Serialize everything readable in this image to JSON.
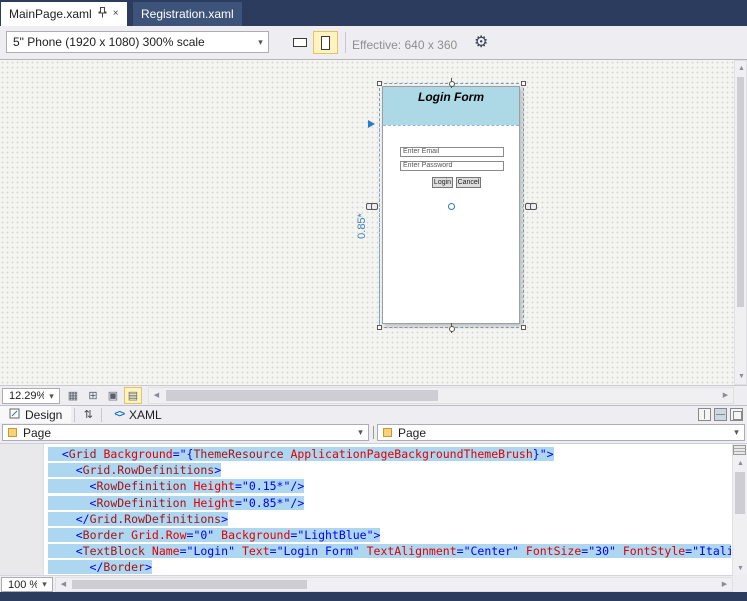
{
  "window": {
    "document_tabs": [
      {
        "label": "MainPage.xaml",
        "active": true
      },
      {
        "label": "Registration.xaml",
        "active": false
      }
    ]
  },
  "icons": {
    "close": "×",
    "dropdown_arrow": "▾",
    "gear": "⚙",
    "swap_panes": "⇅",
    "scroll_left": "◀",
    "scroll_right": "▶",
    "scroll_up": "▲",
    "scroll_down": "▼",
    "show_grid": "▦",
    "snap_grid": "⊞",
    "snaplines": "▣",
    "artboard_background": "▤",
    "xaml_tag": "<>"
  },
  "device_toolbar": {
    "device_selector_value": "5\" Phone (1920 x 1080) 300% scale",
    "effective_label": "Effective: 640 x 360"
  },
  "designer": {
    "zoom_value": "12.29%",
    "artboard": {
      "title": "Login Form",
      "email_placeholder": "Enter Email",
      "password_placeholder": "Enter Password",
      "login_button_label": "Login",
      "cancel_button_label": "Cancel",
      "row_height_label": "0.85*"
    }
  },
  "split_bar": {
    "design_tab_label": "Design",
    "xaml_tab_label": "XAML"
  },
  "breadcrumbs": {
    "left_value": "Page",
    "right_value": "Page"
  },
  "editor": {
    "zoom_value": "100 %",
    "lines": [
      {
        "indent": 1,
        "selected": true,
        "tokens": [
          [
            "d",
            "<"
          ],
          [
            "e",
            "Grid"
          ],
          [
            "t",
            " "
          ],
          [
            "a",
            "Background"
          ],
          [
            "d",
            "="
          ],
          [
            "v",
            "\"{"
          ],
          [
            "e",
            "ThemeResource"
          ],
          [
            "t",
            " "
          ],
          [
            "a",
            "ApplicationPageBackgroundThemeBrush"
          ],
          [
            "v",
            "}\""
          ],
          [
            "d",
            ">"
          ]
        ]
      },
      {
        "indent": 2,
        "selected": true,
        "tokens": [
          [
            "d",
            "<"
          ],
          [
            "e",
            "Grid.RowDefinitions"
          ],
          [
            "d",
            ">"
          ]
        ]
      },
      {
        "indent": 3,
        "selected": true,
        "tokens": [
          [
            "d",
            "<"
          ],
          [
            "e",
            "RowDefinition"
          ],
          [
            "t",
            " "
          ],
          [
            "a",
            "Height"
          ],
          [
            "d",
            "="
          ],
          [
            "v",
            "\"0.15*\""
          ],
          [
            "d",
            "/>"
          ]
        ]
      },
      {
        "indent": 3,
        "selected": true,
        "tokens": [
          [
            "d",
            "<"
          ],
          [
            "e",
            "RowDefinition"
          ],
          [
            "t",
            " "
          ],
          [
            "a",
            "Height"
          ],
          [
            "d",
            "="
          ],
          [
            "v",
            "\"0.85*\""
          ],
          [
            "d",
            "/>"
          ]
        ]
      },
      {
        "indent": 2,
        "selected": true,
        "tokens": [
          [
            "d",
            "</"
          ],
          [
            "e",
            "Grid.RowDefinitions"
          ],
          [
            "d",
            ">"
          ]
        ]
      },
      {
        "indent": 2,
        "selected": true,
        "tokens": [
          [
            "d",
            "<"
          ],
          [
            "e",
            "Border"
          ],
          [
            "t",
            " "
          ],
          [
            "a",
            "Grid.Row"
          ],
          [
            "d",
            "="
          ],
          [
            "v",
            "\"0\""
          ],
          [
            "t",
            " "
          ],
          [
            "a",
            "Background"
          ],
          [
            "d",
            "="
          ],
          [
            "v",
            "\"LightBlue\""
          ],
          [
            "d",
            ">"
          ]
        ]
      },
      {
        "indent": 2,
        "selected": true,
        "tokens": [
          [
            "d",
            "<"
          ],
          [
            "e",
            "TextBlock"
          ],
          [
            "t",
            " "
          ],
          [
            "a",
            "Name"
          ],
          [
            "d",
            "="
          ],
          [
            "v",
            "\"Login\""
          ],
          [
            "t",
            " "
          ],
          [
            "a",
            "Text"
          ],
          [
            "d",
            "="
          ],
          [
            "v",
            "\"Login Form\""
          ],
          [
            "t",
            " "
          ],
          [
            "a",
            "TextAlignment"
          ],
          [
            "d",
            "="
          ],
          [
            "v",
            "\"Center\""
          ],
          [
            "t",
            " "
          ],
          [
            "a",
            "FontSize"
          ],
          [
            "d",
            "="
          ],
          [
            "v",
            "\"30\""
          ],
          [
            "t",
            " "
          ],
          [
            "a",
            "FontStyle"
          ],
          [
            "d",
            "="
          ],
          [
            "v",
            "\"Italic\""
          ]
        ]
      },
      {
        "indent": 3,
        "selected": true,
        "tokens": [
          [
            "d",
            "</"
          ],
          [
            "e",
            "Border"
          ],
          [
            "d",
            ">"
          ]
        ]
      }
    ]
  },
  "colors": {
    "tab_bar_background": "#2B3C5F",
    "artboard_header": "#ADD8E6",
    "code_selection_highlight": "#ADD6F0",
    "xml_element": "#A31515",
    "xml_attribute": "#E00000",
    "xml_value": "#0000FF"
  }
}
